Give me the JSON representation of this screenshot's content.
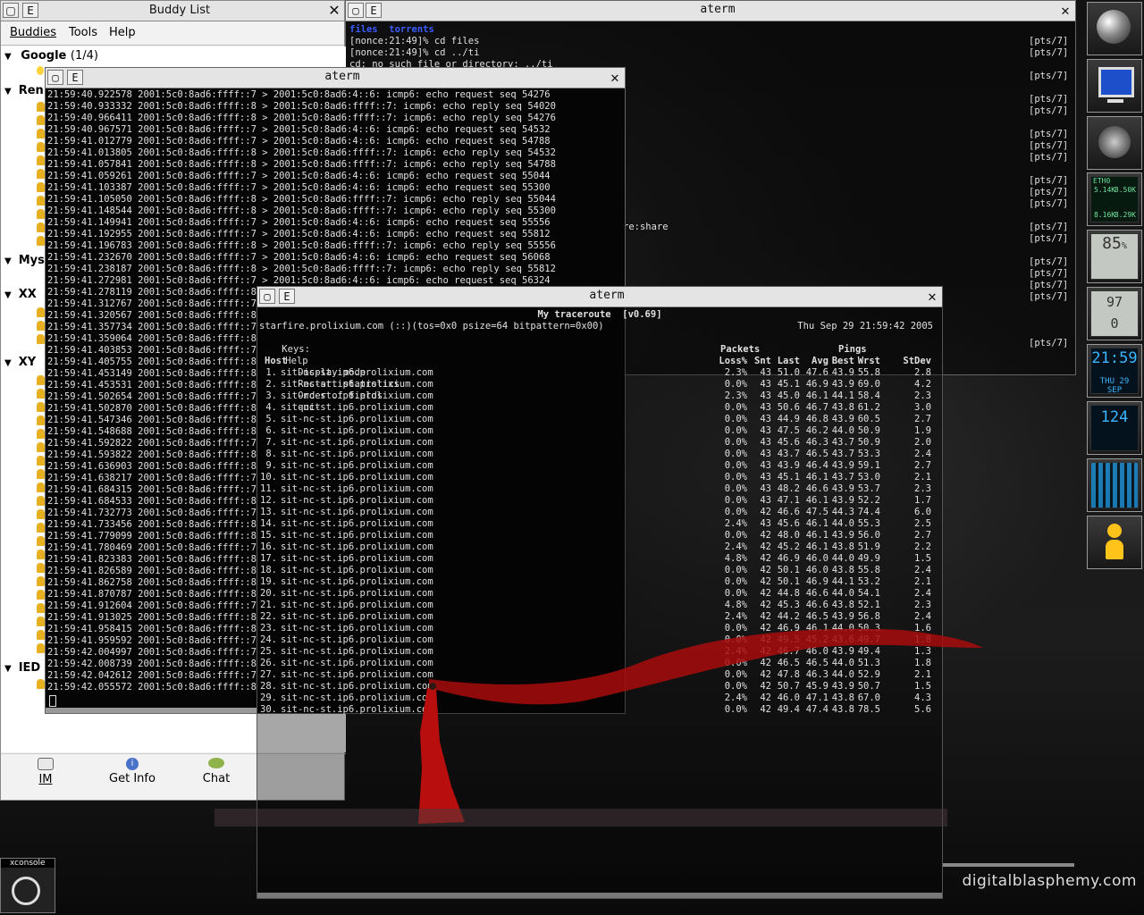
{
  "buddy_list": {
    "title": "Buddy List",
    "menu": [
      "Buddies",
      "Tools",
      "Help"
    ],
    "groups": [
      {
        "name": "Google",
        "count": "(1/4)"
      },
      {
        "name": "Ren"
      },
      {
        "name": "Mys"
      },
      {
        "name": "XX"
      },
      {
        "name": "XY"
      },
      {
        "name": "IED"
      }
    ],
    "buttons": {
      "im": "IM",
      "info": "Get Info",
      "chat": "Chat"
    }
  },
  "term_back": {
    "title": "aterm",
    "lines": [
      "files  torrents",
      "[nonce:21:49]% cd files",
      "[nonce:21:49]% cd ../ti",
      "cd: no such file or directory: ../ti"
    ],
    "fragment": "re:share",
    "pts": [
      "[pts/7]",
      "[pts/7]",
      "[pts/7]",
      "[pts/7]",
      "[pts/7]",
      "[pts/7]",
      "[pts/7]",
      "[pts/7]",
      "[pts/7]",
      "[pts/7]",
      "[pts/7]",
      "[pts/7]",
      "[pts/7]",
      "[pts/7]",
      "[pts/7]",
      "[pts/7]",
      "[pts/7]",
      "[pts/7]",
      "[pts/7]",
      "[pts/7]"
    ]
  },
  "term_dump": {
    "title": "aterm",
    "lines": [
      "21:59:40.922578 2001:5c0:8ad6:ffff::7 > 2001:5c0:8ad6:4::6: icmp6: echo request seq 54276",
      "21:59:40.933332 2001:5c0:8ad6:ffff::8 > 2001:5c0:8ad6:ffff::7: icmp6: echo reply seq 54020",
      "21:59:40.966411 2001:5c0:8ad6:ffff::8 > 2001:5c0:8ad6:ffff::7: icmp6: echo reply seq 54276",
      "21:59:40.967571 2001:5c0:8ad6:ffff::7 > 2001:5c0:8ad6:4::6: icmp6: echo request seq 54532",
      "21:59:41.012779 2001:5c0:8ad6:ffff::7 > 2001:5c0:8ad6:4::6: icmp6: echo request seq 54788",
      "21:59:41.013805 2001:5c0:8ad6:ffff::8 > 2001:5c0:8ad6:ffff::7: icmp6: echo reply seq 54532",
      "21:59:41.057841 2001:5c0:8ad6:ffff::8 > 2001:5c0:8ad6:ffff::7: icmp6: echo reply seq 54788",
      "21:59:41.059261 2001:5c0:8ad6:ffff::7 > 2001:5c0:8ad6:4::6: icmp6: echo request seq 55044",
      "21:59:41.103387 2001:5c0:8ad6:ffff::7 > 2001:5c0:8ad6:4::6: icmp6: echo request seq 55300",
      "21:59:41.105050 2001:5c0:8ad6:ffff::8 > 2001:5c0:8ad6:ffff::7: icmp6: echo reply seq 55044",
      "21:59:41.148544 2001:5c0:8ad6:ffff::8 > 2001:5c0:8ad6:ffff::7: icmp6: echo reply seq 55300",
      "21:59:41.149941 2001:5c0:8ad6:ffff::7 > 2001:5c0:8ad6:4::6: icmp6: echo request seq 55556",
      "21:59:41.192955 2001:5c0:8ad6:ffff::7 > 2001:5c0:8ad6:4::6: icmp6: echo request seq 55812",
      "21:59:41.196783 2001:5c0:8ad6:ffff::8 > 2001:5c0:8ad6:ffff::7: icmp6: echo reply seq 55556",
      "21:59:41.232670 2001:5c0:8ad6:ffff::7 > 2001:5c0:8ad6:4::6: icmp6: echo request seq 56068",
      "21:59:41.238187 2001:5c0:8ad6:ffff::8 > 2001:5c0:8ad6:ffff::7: icmp6: echo reply seq 55812",
      "21:59:41.272981 2001:5c0:8ad6:ffff::7 > 2001:5c0:8ad6:4::6: icmp6: echo request seq 56324",
      "21:59:41.278119 2001:5c0:8ad6:ffff::8",
      "21:59:41.312767 2001:5c0:8ad6:ffff::7",
      "21:59:41.320567 2001:5c0:8ad6:ffff::8",
      "21:59:41.357734 2001:5c0:8ad6:ffff::7",
      "21:59:41.359064 2001:5c0:8ad6:ffff::8",
      "21:59:41.403853 2001:5c0:8ad6:ffff::7",
      "21:59:41.405755 2001:5c0:8ad6:ffff::8",
      "21:59:41.453149 2001:5c0:8ad6:ffff::8",
      "21:59:41.453531 2001:5c0:8ad6:ffff::8",
      "21:59:41.502654 2001:5c0:8ad6:ffff::7",
      "21:59:41.502870 2001:5c0:8ad6:ffff::8",
      "21:59:41.547346 2001:5c0:8ad6:ffff::8",
      "21:59:41.548688 2001:5c0:8ad6:ffff::8",
      "21:59:41.592822 2001:5c0:8ad6:ffff::7",
      "21:59:41.593822 2001:5c0:8ad6:ffff::8",
      "21:59:41.636903 2001:5c0:8ad6:ffff::8",
      "21:59:41.638217 2001:5c0:8ad6:ffff::7",
      "21:59:41.684315 2001:5c0:8ad6:ffff::7",
      "21:59:41.684533 2001:5c0:8ad6:ffff::8",
      "21:59:41.732773 2001:5c0:8ad6:ffff::7",
      "21:59:41.733456 2001:5c0:8ad6:ffff::8",
      "21:59:41.779099 2001:5c0:8ad6:ffff::8",
      "21:59:41.780469 2001:5c0:8ad6:ffff::7",
      "21:59:41.823383 2001:5c0:8ad6:ffff::8",
      "21:59:41.826589 2001:5c0:8ad6:ffff::8",
      "21:59:41.862758 2001:5c0:8ad6:ffff::8",
      "21:59:41.870787 2001:5c0:8ad6:ffff::8",
      "21:59:41.912604 2001:5c0:8ad6:ffff::7",
      "21:59:41.913025 2001:5c0:8ad6:ffff::8",
      "21:59:41.958415 2001:5c0:8ad6:ffff::8",
      "21:59:41.959592 2001:5c0:8ad6:ffff::7",
      "21:59:42.004997 2001:5c0:8ad6:ffff::7",
      "21:59:42.008739 2001:5c0:8ad6:ffff::8",
      "21:59:42.042612 2001:5c0:8ad6:ffff::7",
      "21:59:42.055572 2001:5c0:8ad6:ffff::8"
    ]
  },
  "mtr": {
    "title": "aterm",
    "header": "My traceroute  [v0.69]",
    "source": "starfire.prolixium.com (::)(tos=0x0 psize=64 bitpattern=0x00)",
    "datetime": "Thu Sep 29 21:59:42 2005",
    "keys_label": "Keys:",
    "keys": [
      "Help",
      "Display mode",
      "Restart statistics",
      "Order of fields",
      "quit"
    ],
    "group_packets": "Packets",
    "group_pings": "Pings",
    "columns": [
      "Host",
      "Loss%",
      "Snt",
      "Last",
      "Avg",
      "Best",
      "Wrst",
      "StDev"
    ],
    "hops": [
      [
        "1.",
        "sit-nc-st.ip6.prolixium.com",
        "2.3%",
        "43",
        "51.0",
        "47.6",
        "43.9",
        "55.8",
        "2.8"
      ],
      [
        "2.",
        "sit-nc-st.ip6.prolixium.com",
        "0.0%",
        "43",
        "45.1",
        "46.9",
        "43.9",
        "69.0",
        "4.2"
      ],
      [
        "3.",
        "sit-nc-st.ip6.prolixium.com",
        "2.3%",
        "43",
        "45.0",
        "46.1",
        "44.1",
        "58.4",
        "2.3"
      ],
      [
        "4.",
        "sit-nc-st.ip6.prolixium.com",
        "0.0%",
        "43",
        "50.6",
        "46.7",
        "43.8",
        "61.2",
        "3.0"
      ],
      [
        "5.",
        "sit-nc-st.ip6.prolixium.com",
        "0.0%",
        "43",
        "44.9",
        "46.8",
        "43.9",
        "60.5",
        "2.7"
      ],
      [
        "6.",
        "sit-nc-st.ip6.prolixium.com",
        "0.0%",
        "43",
        "47.5",
        "46.2",
        "44.0",
        "50.9",
        "1.9"
      ],
      [
        "7.",
        "sit-nc-st.ip6.prolixium.com",
        "0.0%",
        "43",
        "45.6",
        "46.3",
        "43.7",
        "50.9",
        "2.0"
      ],
      [
        "8.",
        "sit-nc-st.ip6.prolixium.com",
        "0.0%",
        "43",
        "43.7",
        "46.5",
        "43.7",
        "53.3",
        "2.4"
      ],
      [
        "9.",
        "sit-nc-st.ip6.prolixium.com",
        "0.0%",
        "43",
        "43.9",
        "46.4",
        "43.9",
        "59.1",
        "2.7"
      ],
      [
        "10.",
        "sit-nc-st.ip6.prolixium.com",
        "0.0%",
        "43",
        "45.1",
        "46.1",
        "43.7",
        "53.0",
        "2.1"
      ],
      [
        "11.",
        "sit-nc-st.ip6.prolixium.com",
        "0.0%",
        "43",
        "48.2",
        "46.6",
        "43.9",
        "53.7",
        "2.3"
      ],
      [
        "12.",
        "sit-nc-st.ip6.prolixium.com",
        "0.0%",
        "43",
        "47.1",
        "46.1",
        "43.9",
        "52.2",
        "1.7"
      ],
      [
        "13.",
        "sit-nc-st.ip6.prolixium.com",
        "0.0%",
        "42",
        "46.6",
        "47.5",
        "44.3",
        "74.4",
        "6.0"
      ],
      [
        "14.",
        "sit-nc-st.ip6.prolixium.com",
        "2.4%",
        "43",
        "45.6",
        "46.1",
        "44.0",
        "55.3",
        "2.5"
      ],
      [
        "15.",
        "sit-nc-st.ip6.prolixium.com",
        "0.0%",
        "42",
        "48.0",
        "46.1",
        "43.9",
        "56.0",
        "2.7"
      ],
      [
        "16.",
        "sit-nc-st.ip6.prolixium.com",
        "2.4%",
        "42",
        "45.2",
        "46.1",
        "43.8",
        "51.9",
        "2.2"
      ],
      [
        "17.",
        "sit-nc-st.ip6.prolixium.com",
        "4.8%",
        "42",
        "46.9",
        "46.0",
        "44.0",
        "49.9",
        "1.5"
      ],
      [
        "18.",
        "sit-nc-st.ip6.prolixium.com",
        "0.0%",
        "42",
        "50.1",
        "46.0",
        "43.8",
        "55.8",
        "2.4"
      ],
      [
        "19.",
        "sit-nc-st.ip6.prolixium.com",
        "0.0%",
        "42",
        "50.1",
        "46.9",
        "44.1",
        "53.2",
        "2.1"
      ],
      [
        "20.",
        "sit-nc-st.ip6.prolixium.com",
        "0.0%",
        "42",
        "44.8",
        "46.6",
        "44.0",
        "54.1",
        "2.4"
      ],
      [
        "21.",
        "sit-nc-st.ip6.prolixium.com",
        "4.8%",
        "42",
        "45.3",
        "46.6",
        "43.8",
        "52.1",
        "2.3"
      ],
      [
        "22.",
        "sit-nc-st.ip6.prolixium.com",
        "2.4%",
        "42",
        "44.2",
        "46.5",
        "43.9",
        "56.8",
        "2.4"
      ],
      [
        "23.",
        "sit-nc-st.ip6.prolixium.com",
        "0.0%",
        "42",
        "46.9",
        "46.1",
        "44.0",
        "50.3",
        "1.6"
      ],
      [
        "24.",
        "sit-nc-st.ip6.prolixium.com",
        "0.0%",
        "42",
        "49.5",
        "45.2",
        "43.6",
        "49.7",
        "1.8"
      ],
      [
        "25.",
        "sit-nc-st.ip6.prolixium.com",
        "2.4%",
        "42",
        "46.7",
        "46.0",
        "43.9",
        "49.4",
        "1.3"
      ],
      [
        "26.",
        "sit-nc-st.ip6.prolixium.com",
        "0.0%",
        "42",
        "46.5",
        "46.5",
        "44.0",
        "51.3",
        "1.8"
      ],
      [
        "27.",
        "sit-nc-st.ip6.prolixium.com",
        "0.0%",
        "42",
        "47.8",
        "46.3",
        "44.0",
        "52.9",
        "2.1"
      ],
      [
        "28.",
        "sit-nc-st.ip6.prolixium.com",
        "0.0%",
        "42",
        "50.7",
        "45.9",
        "43.9",
        "50.7",
        "1.5"
      ],
      [
        "29.",
        "sit-nc-st.ip6.prolixium.com",
        "2.4%",
        "42",
        "46.0",
        "47.1",
        "43.8",
        "67.0",
        "4.3"
      ],
      [
        "30.",
        "sit-nc-st.ip6.prolixium.com",
        "0.0%",
        "42",
        "49.4",
        "47.4",
        "43.8",
        "78.5",
        "5.6"
      ]
    ]
  },
  "dock": {
    "net_label": "ETH0",
    "net_up": "5.14K",
    "net_down": "8.50K",
    "net_up2": "8.16K",
    "net_down2": "8.29K",
    "cpu": "85",
    "cpu_unit": "%",
    "mem": "97",
    "swap": "0",
    "clock_time": "21:59",
    "clock_date": "THU 29 SEP",
    "mail": "124"
  },
  "xconsole_label": "xconsole",
  "watermark": "digitalblasphemy.com"
}
